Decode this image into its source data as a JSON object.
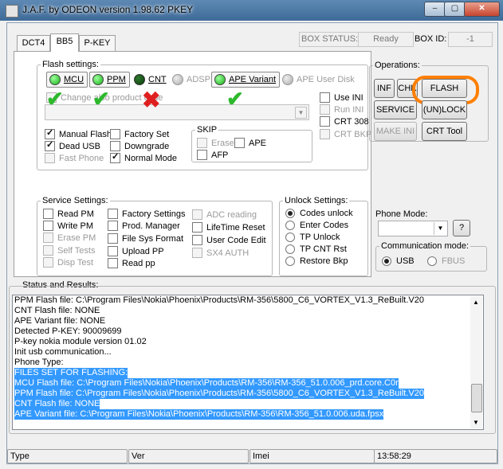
{
  "window": {
    "title": "J.A.F. by ODEON version 1.98.62 PKEY",
    "min_label": "–",
    "max_label": "▢",
    "close_label": "✕"
  },
  "tabs": [
    "DCT4",
    "BB5",
    "P-KEY"
  ],
  "box": {
    "status_label": "BOX STATUS:",
    "status_value": "Ready",
    "id_label": "BOX ID:",
    "id_value": "-1"
  },
  "flash_settings": {
    "legend": "Flash settings:",
    "indicators": [
      {
        "label": "MCU",
        "color": "green"
      },
      {
        "label": "PPM",
        "color": "green"
      },
      {
        "label": "CNT",
        "color": "dkgreen"
      },
      {
        "label": "ADSP",
        "color": "grey"
      },
      {
        "label": "APE Variant",
        "color": "green"
      },
      {
        "label": "APE User Disk",
        "color": "grey"
      }
    ],
    "change_product_code": "Change also product code",
    "use_ini": "Use INI",
    "run_ini": "Run INI",
    "crt308": "CRT 308",
    "crt_bkp": "CRT BKP",
    "manual_flash": "Manual Flash",
    "factory_set": "Factory Set",
    "dead_usb": "Dead USB",
    "downgrade": "Downgrade",
    "fast_phone": "Fast Phone",
    "normal_mode": "Normal Mode",
    "skip_legend": "SKIP",
    "erase": "Erase",
    "ape": "APE",
    "afp": "AFP"
  },
  "annotations": {
    "check_marks": [
      "✔",
      "✔",
      "✔"
    ],
    "cross_mark": "✖"
  },
  "service_settings": {
    "legend": "Service Settings:",
    "col1": [
      "Read PM",
      "Write PM",
      "Erase PM",
      "Self Tests",
      "Disp Test"
    ],
    "col2": [
      "Factory Settings",
      "Prod. Manager",
      "File Sys Format",
      "Upload PP",
      "Read pp"
    ],
    "col3": [
      "ADC reading",
      "LifeTime Reset",
      "User Code Edit",
      "SX4 AUTH"
    ]
  },
  "unlock_settings": {
    "legend": "Unlock Settings:",
    "options": [
      "Codes unlock",
      "Enter Codes",
      "TP Unlock",
      "TP CNT Rst",
      "Restore Bkp"
    ]
  },
  "operations": {
    "legend": "Operations:",
    "inf": "INF",
    "chk": "CHK",
    "flash": "FLASH",
    "service": "SERVICE",
    "unlock": "(UN)LOCK",
    "make_ini": "MAKE INI",
    "crt_tool": "CRT Tool"
  },
  "phone_mode": {
    "label": "Phone Mode:",
    "value": "",
    "help": "?"
  },
  "comm_mode": {
    "legend": "Communication mode:",
    "usb": "USB",
    "fbus": "FBUS"
  },
  "status_results": {
    "legend": "Status and Results:",
    "lines": [
      {
        "text": "PPM Flash file: C:\\Program Files\\Nokia\\Phoenix\\Products\\RM-356\\5800_C6_VORTEX_V1.3_ReBuilt.V20",
        "selected": false
      },
      {
        "text": "CNT Flash file: NONE",
        "selected": false
      },
      {
        "text": "APE Variant file: NONE",
        "selected": false
      },
      {
        "text": "Detected P-KEY: 90009699",
        "selected": false
      },
      {
        "text": "P-key nokia module version 01.02",
        "selected": false
      },
      {
        "text": "Init usb communication...",
        "selected": false
      },
      {
        "text": "Phone Type:",
        "selected": false
      },
      {
        "text": "FILES SET FOR FLASHING:",
        "selected": true
      },
      {
        "text": "MCU Flash file: C:\\Program Files\\Nokia\\Phoenix\\Products\\RM-356\\RM-356_51.0.006_prd.core.C0r",
        "selected": true
      },
      {
        "text": "PPM Flash file: C:\\Program Files\\Nokia\\Phoenix\\Products\\RM-356\\5800_C6_VORTEX_V1.3_ReBuilt.V20",
        "selected": true
      },
      {
        "text": "CNT Flash file: NONE",
        "selected": true
      },
      {
        "text": "APE Variant file: C:\\Program Files\\Nokia\\Phoenix\\Products\\RM-356\\RM-356_51.0.006.uda.fpsx",
        "selected": true
      }
    ]
  },
  "statusbar": {
    "type": "Type",
    "ver": "Ver",
    "imei": "Imei",
    "time": "13:58:29"
  },
  "colors": {
    "highlight": "#3399ff",
    "annotation_orange": "#ff7f00",
    "annotation_green": "#2db82d",
    "annotation_red": "#e02020"
  }
}
